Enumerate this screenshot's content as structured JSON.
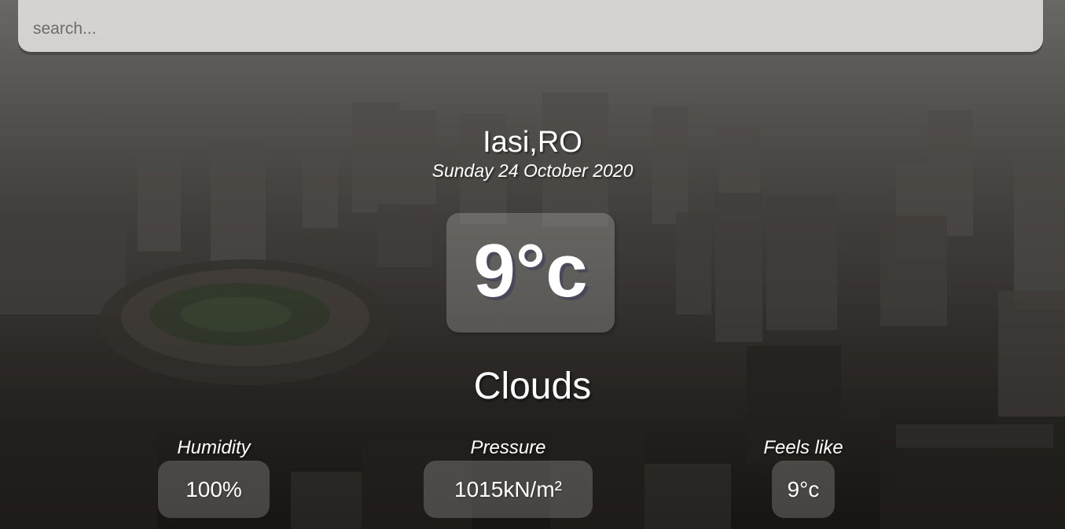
{
  "search": {
    "placeholder": "search...",
    "value": ""
  },
  "location": {
    "city": "Iasi,RO",
    "date": "Sunday 24 October 2020"
  },
  "current": {
    "temperature": "9°c",
    "condition": "Clouds"
  },
  "stats": {
    "humidity": {
      "label": "Humidity",
      "value": "100%"
    },
    "pressure": {
      "label": "Pressure",
      "value": "1015kN/m²"
    },
    "feels_like": {
      "label": "Feels like",
      "value": "9°c"
    }
  },
  "colors": {
    "search_bg": "#dedcd9",
    "text": "#ffffff",
    "card_bg": "rgba(255,255,255,0.2)"
  }
}
